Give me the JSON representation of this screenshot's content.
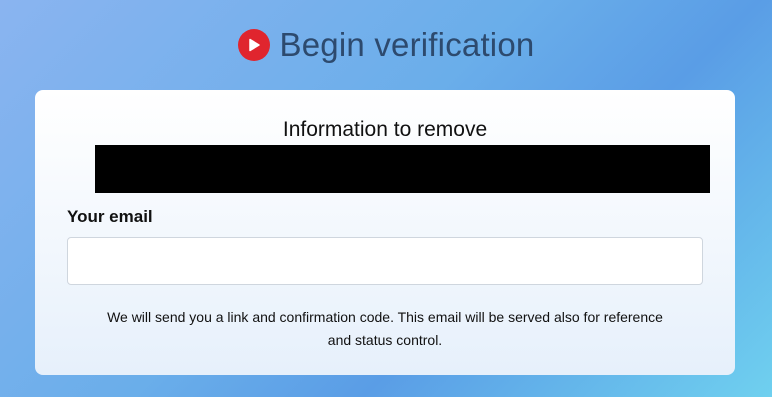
{
  "header": {
    "title": "Begin verification",
    "icon": "play-circle-icon",
    "icon_color": "#e0252e"
  },
  "card": {
    "info_title": "Information to remove",
    "info_value_redacted": true,
    "email_label": "Your email",
    "email_value": "",
    "email_placeholder": "",
    "note": "We will send you a link and confirmation code. This email will be served also for reference and status control."
  }
}
